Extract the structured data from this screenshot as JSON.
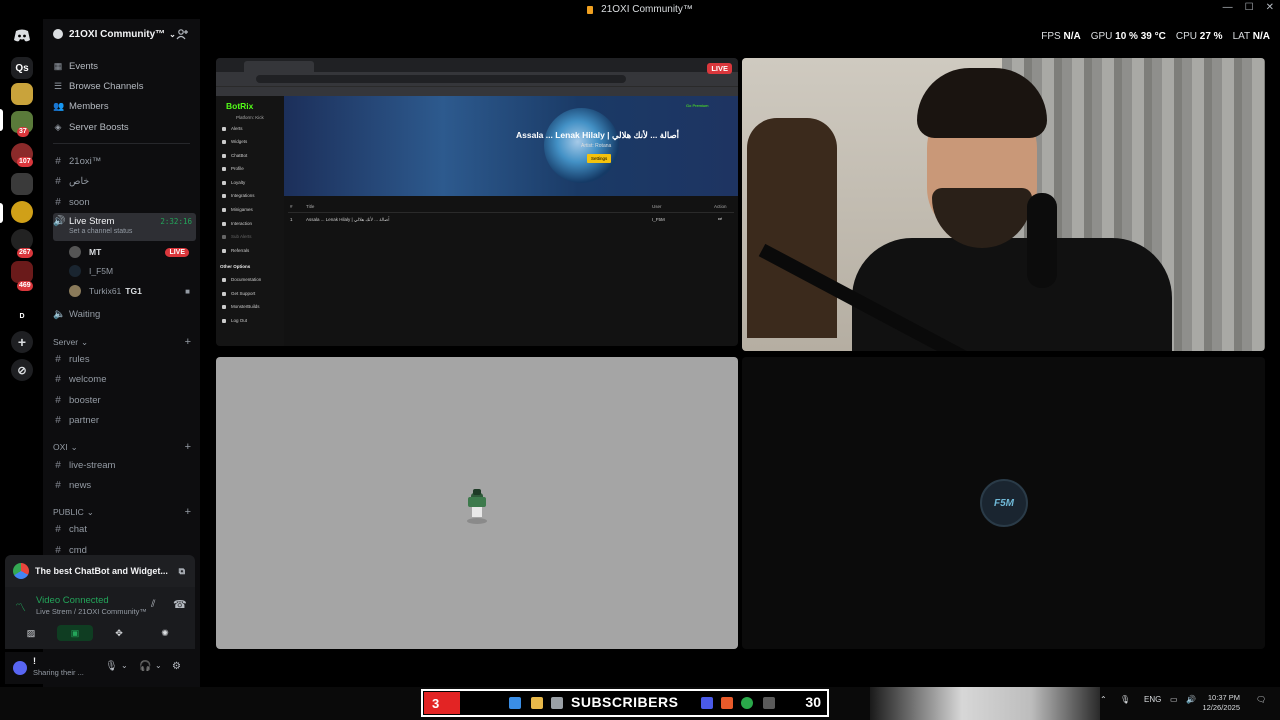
{
  "window": {
    "title": "21OXI Community™"
  },
  "server_rail": {
    "items": [
      {
        "label": "Qs"
      }
    ],
    "badges": [
      "37",
      "107",
      "267",
      "469"
    ],
    "dm_label": "D"
  },
  "guild": {
    "name": "21OXI Community™"
  },
  "nav": {
    "events": "Events",
    "browse_channels": "Browse Channels",
    "members": "Members",
    "server_boosts": "Server Boosts"
  },
  "channels_top": [
    "21oxi™",
    "خاص",
    "soon"
  ],
  "voice_channel": {
    "name": "Live Strem",
    "timer": "2:32:16",
    "status": "Set a channel status",
    "users": [
      {
        "name": "MT",
        "live": "LIVE"
      },
      {
        "name": "I_F5M"
      },
      {
        "name": "Turkix61",
        "tag": "TG1"
      }
    ]
  },
  "waiting": "Waiting",
  "categories": {
    "server": {
      "label": "Server",
      "channels": [
        "rules",
        "welcome",
        "booster",
        "partner"
      ]
    },
    "oxi": {
      "label": "OXI",
      "channels": [
        "live-stream",
        "news"
      ]
    },
    "public": {
      "label": "PUBLIC",
      "channels": [
        "chat",
        "cmd"
      ]
    }
  },
  "activity": {
    "title": "The best ChatBot and Widget..."
  },
  "rtc": {
    "status": "Video Connected",
    "channel": "Live Strem / 21OXI Community™"
  },
  "user_panel": {
    "name": "!",
    "status": "Sharing their ..."
  },
  "overlay": {
    "fps_label": "FPS",
    "fps_value": "N/A",
    "gpu_label": "GPU",
    "gpu_value": "10 %",
    "gpu_temp": "39 °C",
    "cpu_label": "CPU",
    "cpu_value": "27 %",
    "lat_label": "LAT",
    "lat_value": "N/A"
  },
  "stream": {
    "live_badge": "LIVE",
    "botrix": {
      "logo": "BotRix",
      "platform": "Platform: Kick",
      "premium": "Go Premium",
      "menu": [
        "Alerts",
        "Widgets",
        "ChatBot",
        "Profile",
        "Loyalty",
        "Integrations",
        "Minigames",
        "Interaction",
        "Sub Alerts",
        "Referrals"
      ],
      "other_heading": "Other Options",
      "other_menu": [
        "Documentation",
        "Get Support",
        "MonsterBuilds",
        "Log Out"
      ],
      "song_title": "Assala ... Lenak Hilaly | أصالة ... لأنك هلالي",
      "artist": "Artist: Rotana",
      "settings_btn": "Settings",
      "table_headers": [
        "#",
        "Title",
        "User",
        "Action"
      ],
      "table_row": {
        "index": "1",
        "title": "Assala ... Lenak Hilaly | أصالة ... لأنك هلالي",
        "user": "I_F5M"
      }
    },
    "avatar_text": "F5M"
  },
  "taskbar": {
    "subs_left": "3",
    "subs_label": "SUBSCRIBERS",
    "subs_right": "30",
    "lang": "ENG",
    "time": "10:37 PM",
    "date": "12/26/2025"
  }
}
